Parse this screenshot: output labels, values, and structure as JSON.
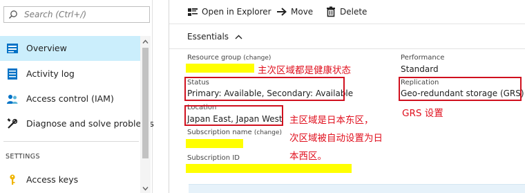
{
  "search": {
    "placeholder": "Search (Ctrl+/)"
  },
  "nav": {
    "items": [
      {
        "label": "Overview",
        "icon": "overview-icon"
      },
      {
        "label": "Activity log",
        "icon": "activity-log-icon"
      },
      {
        "label": "Access control (IAM)",
        "icon": "iam-icon"
      },
      {
        "label": "Diagnose and solve problems",
        "icon": "wrench-icon"
      }
    ],
    "section_settings": "SETTINGS",
    "settings_items": [
      {
        "label": "Access keys",
        "icon": "key-icon"
      }
    ]
  },
  "toolbar": {
    "open_explorer": "Open in Explorer",
    "move": "Move",
    "delete": "Delete"
  },
  "essentials": {
    "title": "Essentials",
    "resource_group_label": "Resource group",
    "change_link": "(change)",
    "status_label": "Status",
    "status_value": "Primary: Available, Secondary: Available",
    "location_label": "Location",
    "location_value": "Japan East, Japan West",
    "subscription_name_label": "Subscription name",
    "subscription_id_label": "Subscription ID",
    "performance_label": "Performance",
    "performance_value": "Standard",
    "replication_label": "Replication",
    "replication_value": "Geo-redundant storage (GRS)"
  },
  "annotations": {
    "health": "主次区域都是健康状态",
    "grs": "GRS 设置",
    "region_line1": "主区域是日本东区，",
    "region_line2": "次区域被自动设置为日",
    "region_line3": "本西区。"
  },
  "colors": {
    "selected_nav": "#cbeefc",
    "annotation_red": "#e0101e",
    "redaction_yellow": "#ffff00",
    "azure_blue": "#0072c6"
  }
}
